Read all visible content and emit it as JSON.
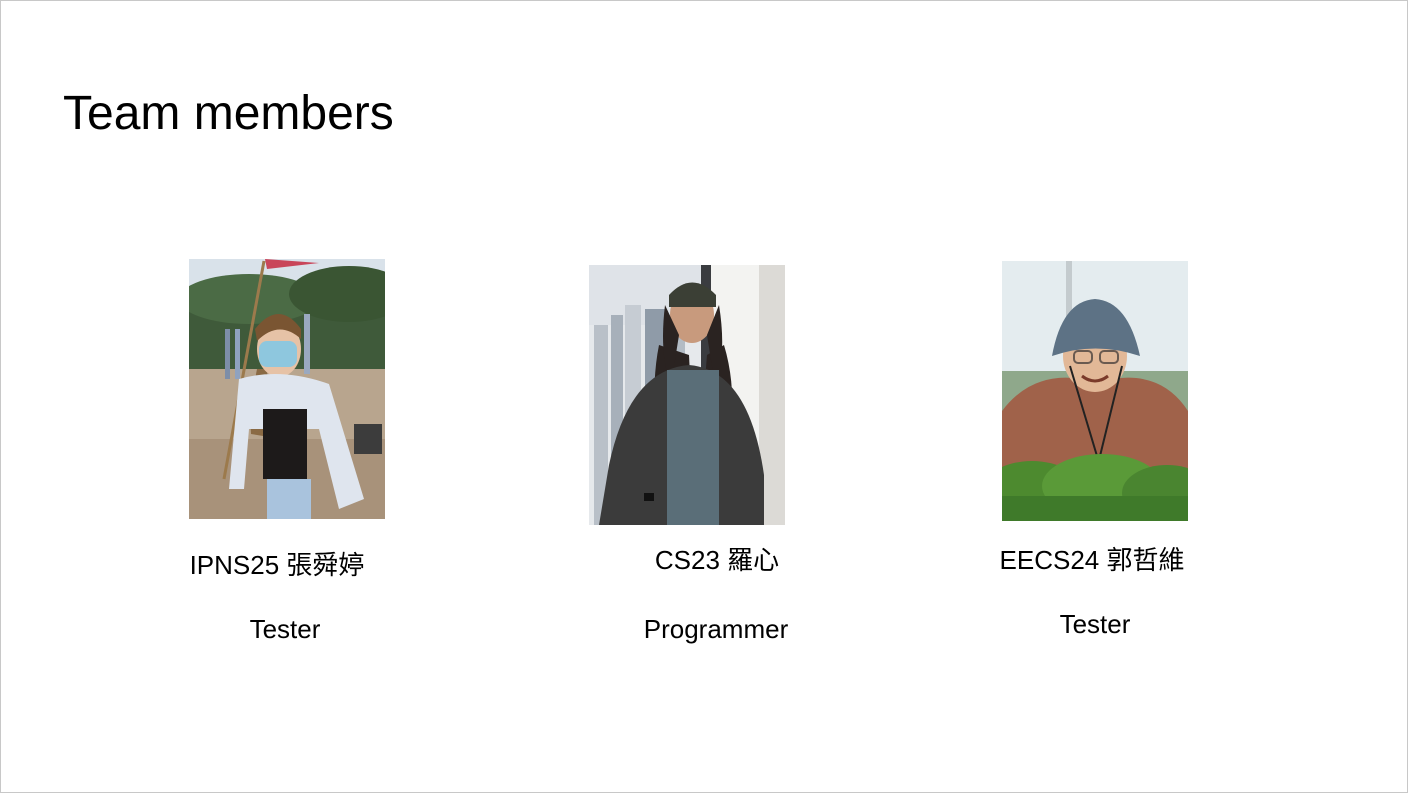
{
  "slide": {
    "title": "Team members"
  },
  "members": [
    {
      "name": "IPNS25 張舜婷",
      "role": "Tester",
      "photo_icon": "person-photo-icon"
    },
    {
      "name": "CS23 羅心",
      "role": "Programmer",
      "photo_icon": "person-photo-icon"
    },
    {
      "name": "EECS24 郭哲維",
      "role": "Tester",
      "photo_icon": "person-photo-icon"
    }
  ],
  "colors": {
    "text": "#000000",
    "background": "#ffffff",
    "border": "#c8c8c8"
  }
}
